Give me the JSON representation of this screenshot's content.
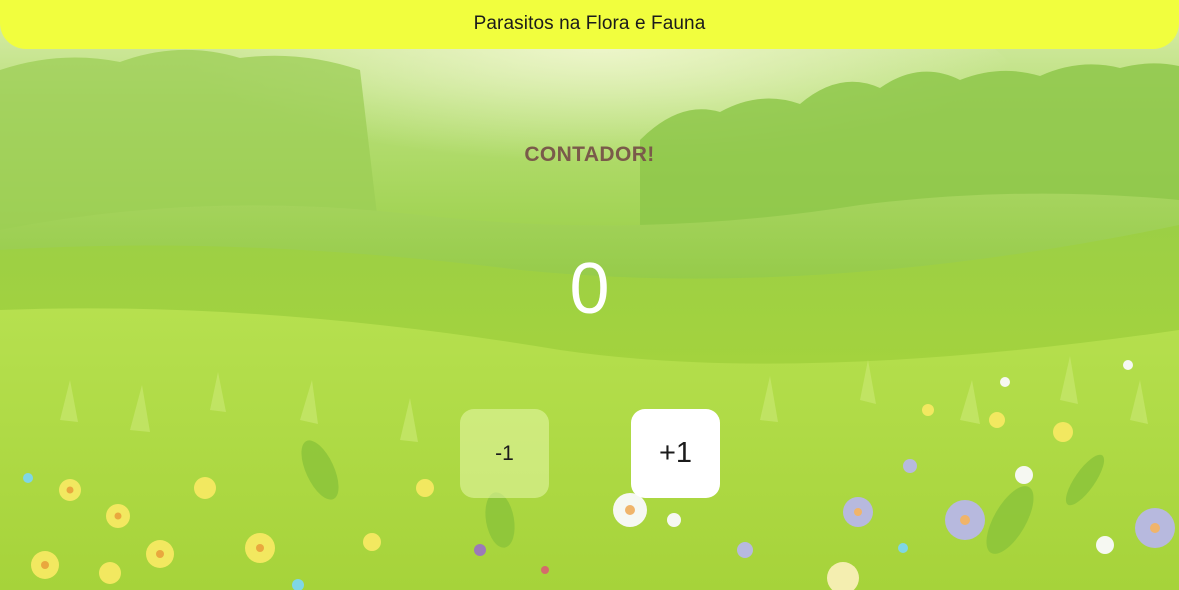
{
  "header": {
    "title": "Parasitos na Flora e Fauna",
    "background_color": "#f1fe3e"
  },
  "counter": {
    "heading": "CONTADOR!",
    "value": "0",
    "decrement_label": "-1",
    "increment_label": "+1",
    "heading_color": "#7a5a4a"
  },
  "background": {
    "description_icon": "meadow-illustration"
  }
}
